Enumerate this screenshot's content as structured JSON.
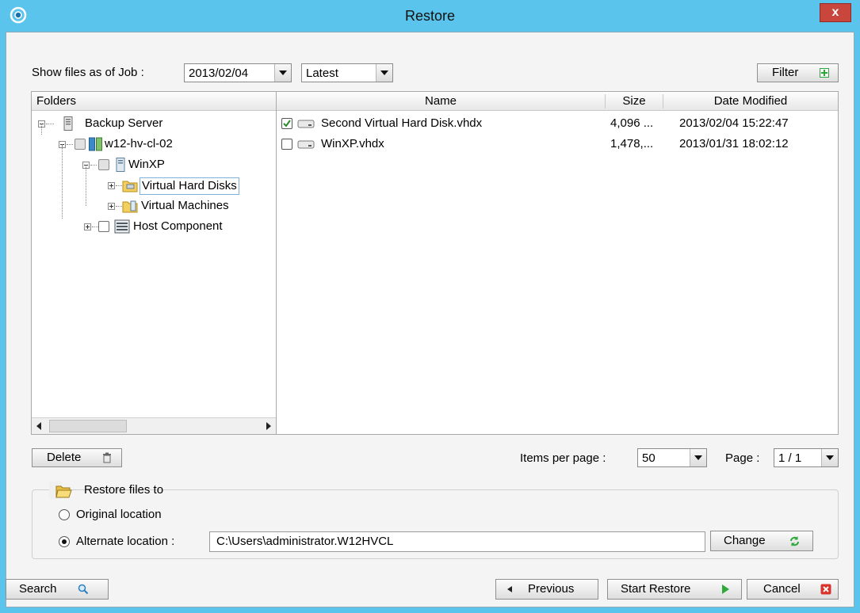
{
  "window": {
    "title": "Restore",
    "close_label": "x"
  },
  "toolbar": {
    "show_files_label": "Show files as of Job :",
    "date_value": "2013/02/04",
    "version_value": "Latest",
    "filter_label": "Filter"
  },
  "folders": {
    "header": "Folders",
    "tree": [
      {
        "label": "Backup Server"
      },
      {
        "label": "w12-hv-cl-02"
      },
      {
        "label": "WinXP"
      },
      {
        "label": "Virtual Hard Disks"
      },
      {
        "label": "Virtual Machines"
      },
      {
        "label": "Host Component"
      }
    ]
  },
  "files": {
    "columns": {
      "name": "Name",
      "size": "Size",
      "date": "Date Modified"
    },
    "rows": [
      {
        "name": "Second Virtual Hard Disk.vhdx",
        "size": "4,096 ...",
        "date": "2013/02/04 15:22:47",
        "checked": true
      },
      {
        "name": "WinXP.vhdx",
        "size": "1,478,...",
        "date": "2013/01/31 18:02:12",
        "checked": false
      }
    ]
  },
  "pager": {
    "delete_label": "Delete",
    "items_per_page_label": "Items per page :",
    "items_per_page_value": "50",
    "page_label": "Page :",
    "page_value": "1 / 1"
  },
  "restore_to": {
    "title": "Restore files to",
    "original_label": "Original location",
    "alternate_label": "Alternate location :",
    "alternate_path": "C:\\Users\\administrator.W12HVCL",
    "change_label": "Change",
    "selected": "alternate"
  },
  "footer": {
    "search_label": "Search",
    "previous_label": "Previous",
    "start_label": "Start Restore",
    "cancel_label": "Cancel"
  },
  "colors": {
    "titlebar": "#5bc4ec",
    "close": "#c9463d",
    "accent_green": "#2fa83a"
  }
}
